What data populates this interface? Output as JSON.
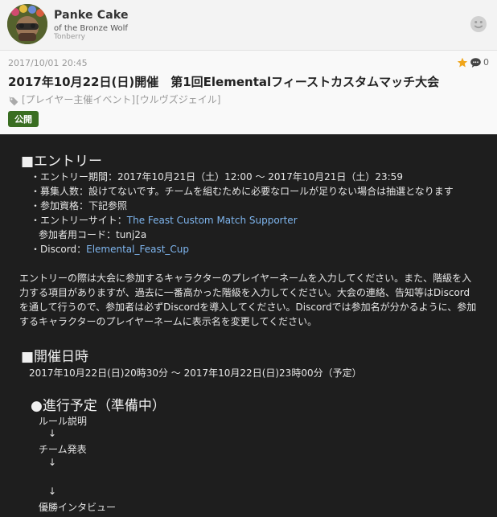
{
  "author": {
    "name": "Panke Cake",
    "title": "of the Bronze Wolf",
    "world": "Tonberry"
  },
  "post": {
    "datetime": "2017/10/01 20:45",
    "like_count": "0",
    "title": "2017年10月22日(日)開催　第1回Elementalフィーストカスタムマッチ大会",
    "tags": [
      "[プレイヤー主催イベント]",
      "[ウルヴズジェイル]"
    ],
    "visibility_badge": "公開"
  },
  "content": {
    "entry_heading": "■エントリー",
    "entry_period": "・エントリー期間：2017年10月21日（土）12:00 ～ 2017年10月21日（土）23:59",
    "recruit_count": "・募集人数：設けてないです。チームを組むために必要なロールが足りない場合は抽選となります",
    "qualification": "・参加資格：下記参照",
    "entry_site_label": "・エントリーサイト：",
    "entry_site_link": "The Feast Custom Match Supporter",
    "participant_code": "参加者用コード：tunj2a",
    "discord_label": "・Discord：",
    "discord_link": "Elemental_Feast_Cup",
    "notes": [
      "エントリーの際は大会に参加するキャラクターのプレイヤーネームを入力してください。また、階級を入",
      "力する項目がありますが、過去に一番高かった階級を入力してください。大会の連絡、告知等はDiscord",
      "を通して行うので、参加者は必ずDiscordを導入してください。Discordでは参加名が分かるように、参加",
      "するキャラクターのプレイヤーネームに表示名を変更してください。"
    ],
    "date_heading": "■開催日時",
    "date_range": "2017年10月22日(日)20時30分 ～ 2017年10月22日(日)23時00分（予定）",
    "schedule_heading": "●進行予定（準備中）",
    "schedule_items": [
      "ルール説明",
      "チーム発表",
      "優勝インタビュー"
    ],
    "arrow": "↓"
  },
  "icons": {
    "avatar": "avatar-image",
    "face": "face-icon",
    "star": "star-icon",
    "comment": "comment-icon",
    "tag": "tag-icon"
  },
  "colors": {
    "badge": "#3a6e22",
    "link": "#7fb6ef",
    "star": "#f0a51a",
    "body_background": "#1e1e1e"
  }
}
